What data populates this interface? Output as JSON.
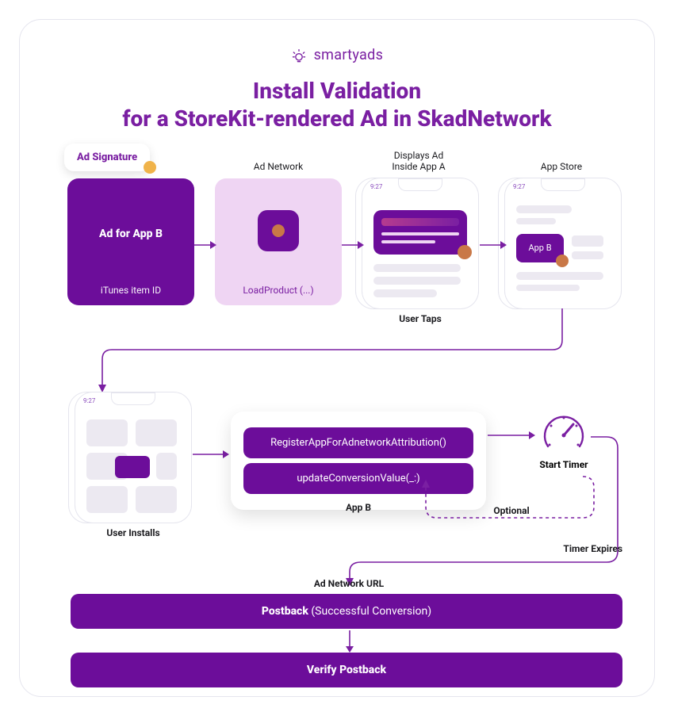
{
  "brand": "smartyads",
  "title_line1": "Install Validation",
  "title_line2": "for a StoreKit-rendered Ad in SkadNetwork",
  "chip_ad_signature": "Ad Signature",
  "labels": {
    "ad_network": "Ad Network",
    "displays_ad_l1": "Displays Ad",
    "displays_ad_l2": "Inside App A",
    "app_store": "App Store",
    "user_taps": "User Taps",
    "user_installs": "User Installs",
    "app_b": "App B",
    "optional": "Optional",
    "start_timer": "Start Timer",
    "timer_expires": "Timer Expires",
    "ad_network_url": "Ad Network URL"
  },
  "adbox": {
    "title": "Ad for App B",
    "subtitle": "iTunes item ID"
  },
  "netbox": {
    "fn": "LoadProduct (...)"
  },
  "phone_time": "9:27",
  "store_app_label": "App B",
  "api": {
    "fn1": "RegisterAppForAdnetworkAttribution()",
    "fn2": "updateConversionValue(_:)"
  },
  "bars": {
    "postback_strong": "Postback",
    "postback_rest": " (Successful Conversion)",
    "verify": "Verify Postback"
  }
}
